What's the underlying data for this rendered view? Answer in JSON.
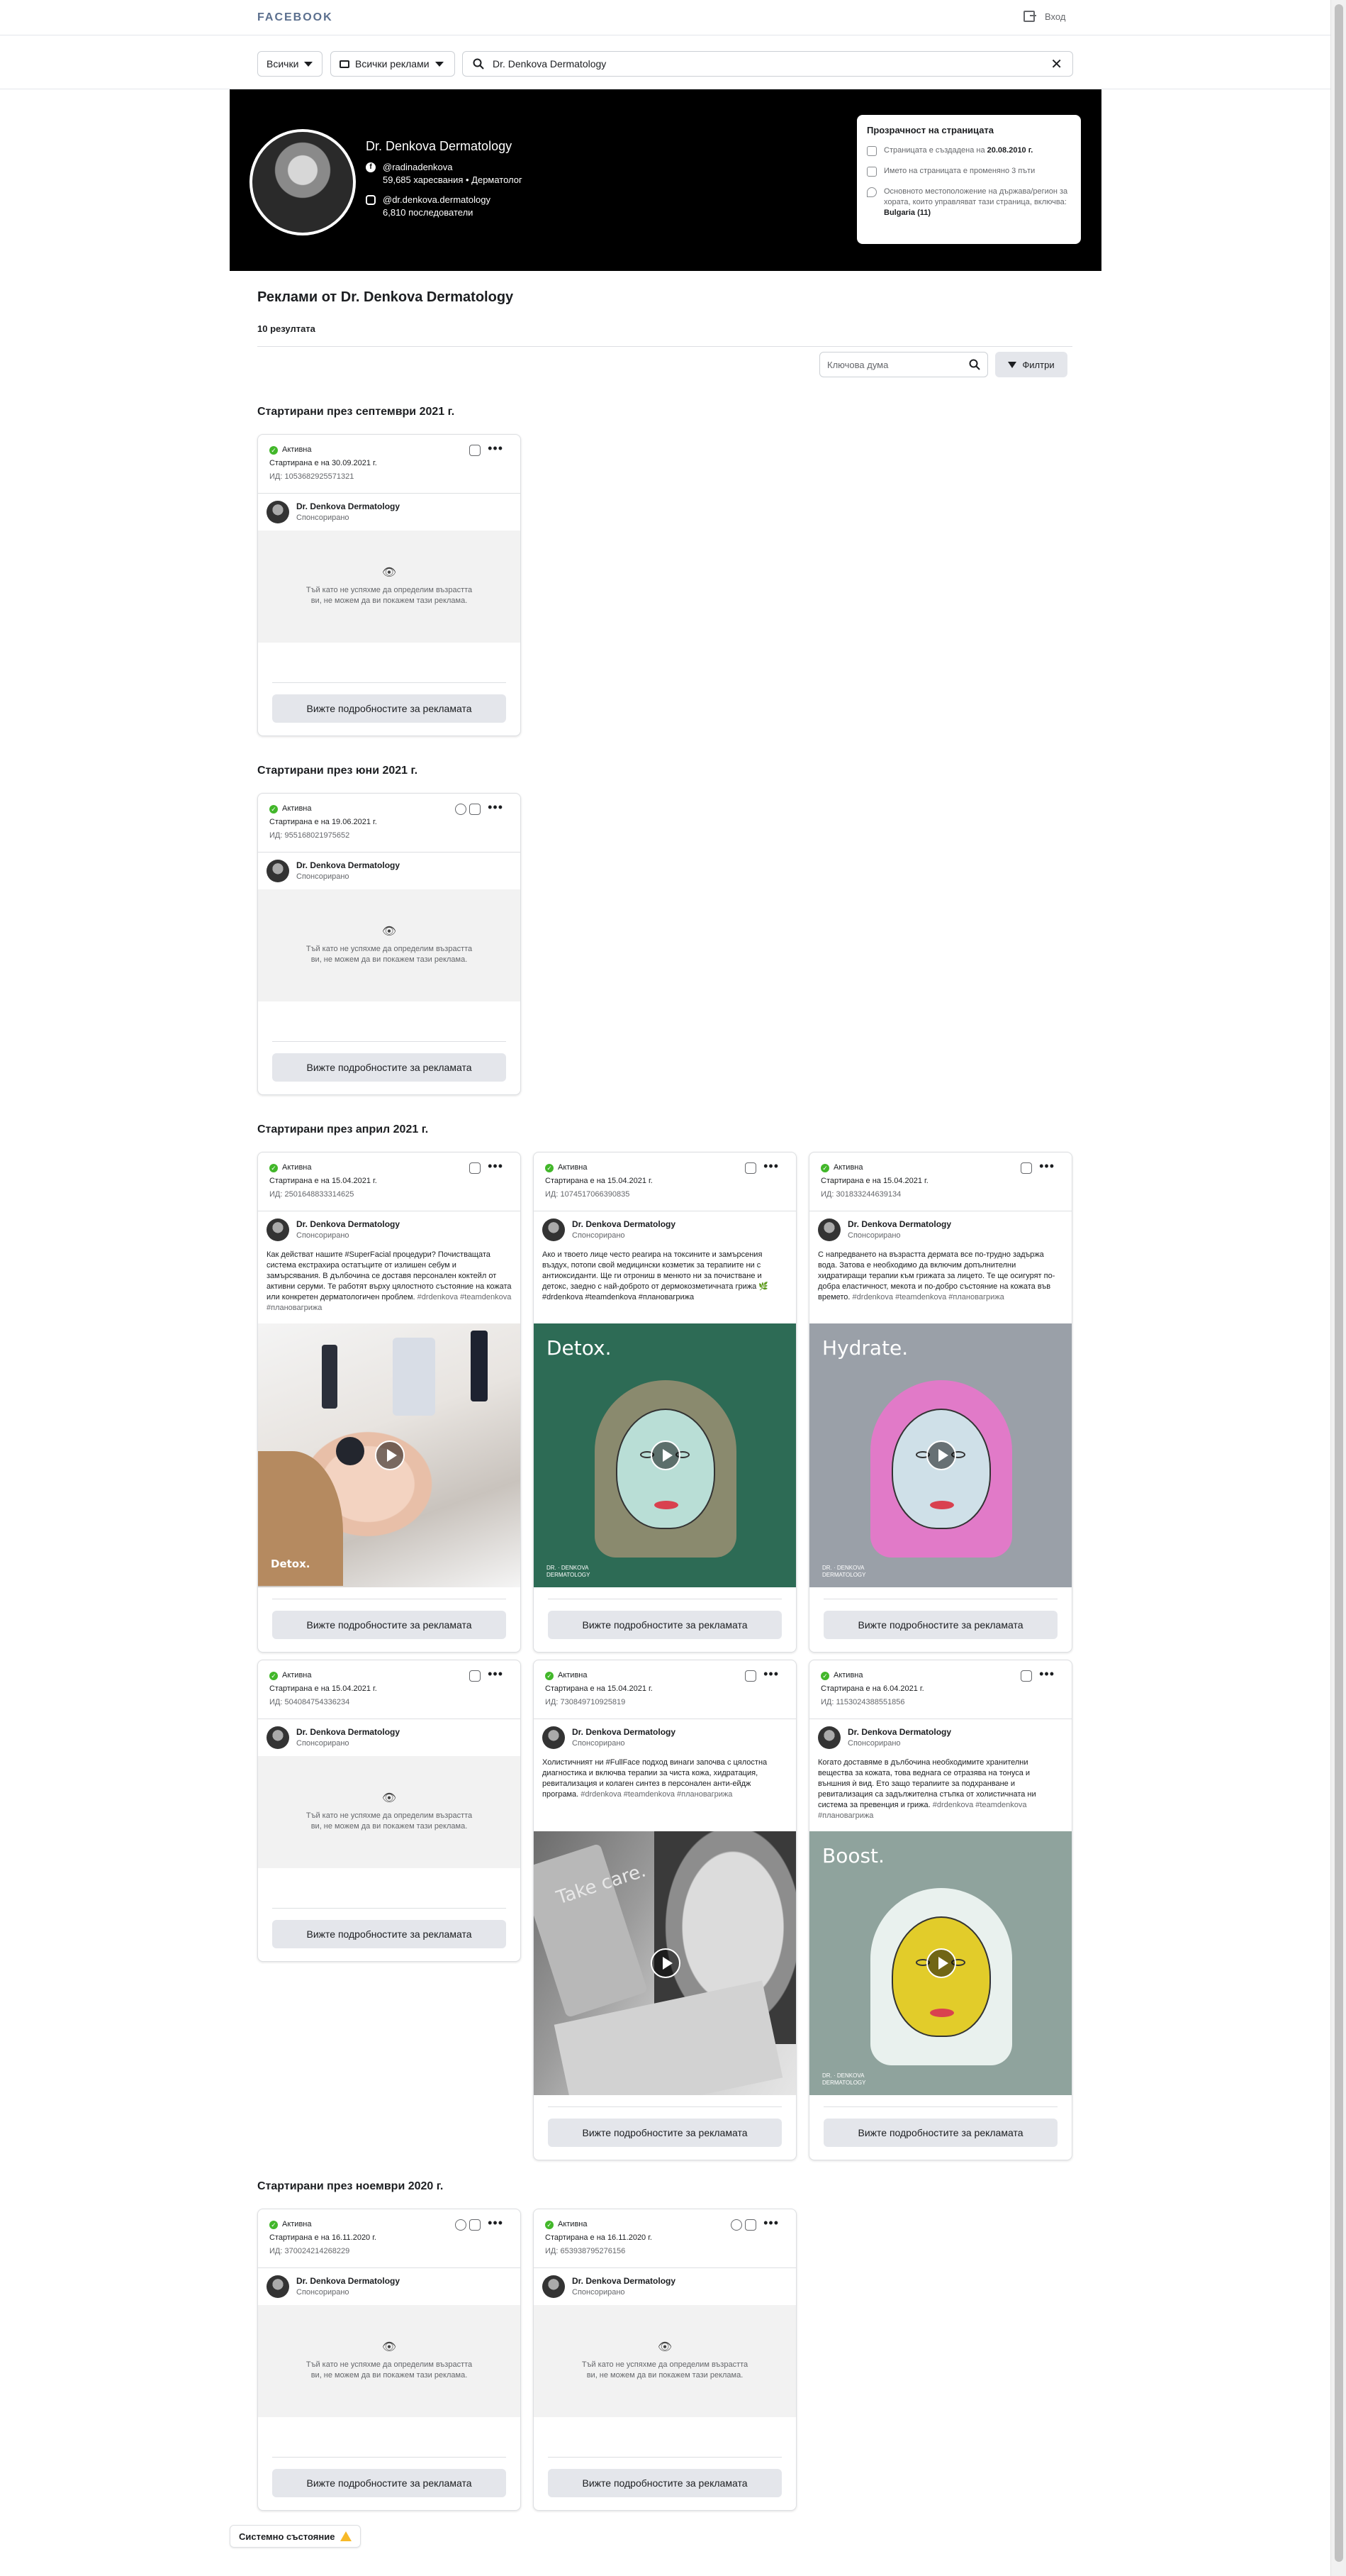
{
  "header": {
    "logo": "FACEBOOK",
    "login": "Вход"
  },
  "filters": {
    "country": "Всички",
    "ad_type": "Всички реклами",
    "search_value": "Dr. Denkova Dermatology"
  },
  "page": {
    "name": "Dr. Denkova Dermatology",
    "fb_handle": "@radinadenkova",
    "fb_stats": "59,685 харесвания • Дерматолог",
    "ig_handle": "@dr.denkova.dermatology",
    "ig_stats": "6,810 последователи"
  },
  "transparency": {
    "title": "Прозрачност на страницата",
    "created_prefix": "Страницата е създадена на ",
    "created_date": "20.08.2010 г.",
    "renamed": "Името на страницата е променяно 3 пъти",
    "location_text": "Основното местоположение на държава/регион за хората, които управляват тази страница, включва:",
    "location_value": "Bulgaria (11)"
  },
  "results": {
    "title": "Реклами от Dr. Denkova Dermatology",
    "count": "10 резултата",
    "keyword_placeholder": "Ключова дума",
    "filters_label": "Филтри"
  },
  "sections": {
    "sep2021": "Стартирани през септември 2021 г.",
    "jun2021": "Стартирани през юни 2021 г.",
    "apr2021": "Стартирани през април 2021 г.",
    "nov2020": "Стартирани през ноември 2020 г."
  },
  "common": {
    "status": "Активна",
    "advertiser": "Dr. Denkova Dermatology",
    "sponsored": "Спонсорирано",
    "not_available": "Тъй като не успяхме да определим възрастта ви, не можем да ви покажем тази реклама.",
    "details_button": "Вижте подробностите за рекламата"
  },
  "ads": [
    {
      "started": "Стартирана е на 30.09.2021 г.",
      "id": "ИД: 1053682925571321"
    },
    {
      "started": "Стартирана е на 19.06.2021 г.",
      "id": "ИД: 955168021975652"
    },
    {
      "started": "Стартирана е на 15.04.2021 г.",
      "id": "ИД: 2501648833314625",
      "text": "Как действат нашите #SuperFacial процедури? Почистващата система екстрахира остатъците от излишен себум и замърсявания. В дълбочина се доставя персонален коктейл от активни серуми. Те работят върху цялостното състояние на кожата или конкретен дерматологичен проблем.",
      "tags": "#drdenkova #teamdenkova #плановагрижа"
    },
    {
      "started": "Стартирана е на 15.04.2021 г.",
      "id": "ИД: 1074517066390835",
      "text": "Ако и твоето лице често реагира на токсините и замърсения въздух, потопи свой медицински козметик за терапиите ни с антиоксиданти. Ще ги отрониш в менюто ни за почистване и детокс, заедно с най-доброто от дермокозметичната грижа 🌿#drdenkova #teamdenkova #плановагрижа",
      "tags": "",
      "media_title": "Detox."
    },
    {
      "started": "Стартирана е на 15.04.2021 г.",
      "id": "ИД: 301833244639134",
      "text": "С напредването на възрастта дермата все по-трудно задържа вода. Затова е необходимо да включим допълнителни хидратиращи терапии към грижата за лицето. Те ще осигурят по-добра еластичност, мекота и по-добро състояние на кожата във времето.",
      "tags": "#drdenkova #teamdenkova #плановагрижа",
      "media_title": "Hydrate."
    },
    {
      "started": "Стартирана е на 15.04.2021 г.",
      "id": "ИД: 504084754336234"
    },
    {
      "started": "Стартирана е на 15.04.2021 г.",
      "id": "ИД: 730849710925819",
      "text": "Холистичният ни #FullFace подход винаги започва с цялостна диагностика и включва терапии за чиста кожа, хидратация, ревитализация и колаген синтез в персонален анти-ейдж програма.",
      "tags": "#drdenkova #teamdenkova #плановагрижа",
      "media_title": "Take care."
    },
    {
      "started": "Стартирана е на 6.04.2021 г.",
      "id": "ИД: 1153024388551856",
      "text": "Когато доставяме в дълбочина необходимите хранителни вещества за кожата, това веднага се отразява на тонуса и външния ѝ вид. Ето защо терапиите за подхранване и ревитализация са задължителна стъпка от холистичната ни система за превенция и грижа.",
      "tags": "#drdenkova #teamdenkova #плановагрижа",
      "media_title": "Boost."
    },
    {
      "started": "Стартирана е на 16.11.2020 г.",
      "id": "ИД: 370024214268229"
    },
    {
      "started": "Стартирана е на 16.11.2020 г.",
      "id": "ИД: 653938795276156"
    }
  ],
  "media_footer": "DR. · DENKOVA\nDERMATOLOGY",
  "media0_caption": "Detox.",
  "footer": {
    "system_status": "Системно състояние"
  },
  "colors": {
    "hero_bg": "#000000",
    "active_green": "#42b72a",
    "button_bg": "#e4e6eb",
    "detox_bg": "#2d6b55",
    "hydrate_bg": "#9aa0a8",
    "boost_bg": "#8fa39d"
  }
}
